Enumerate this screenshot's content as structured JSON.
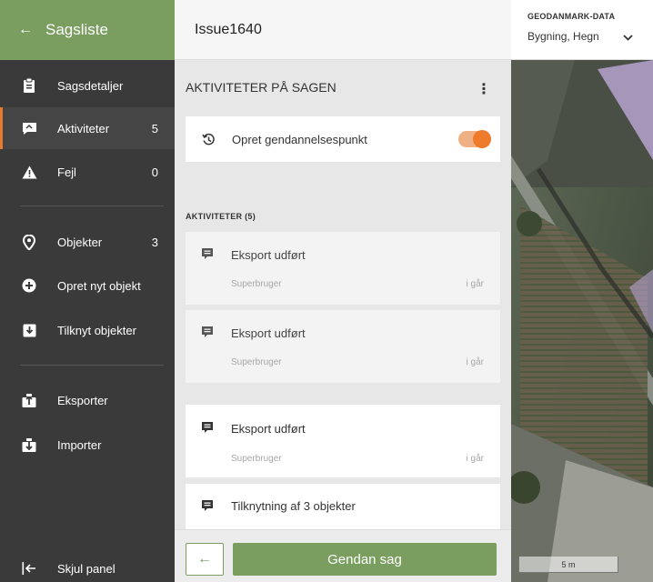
{
  "sidebar": {
    "header_label": "Sagsliste",
    "items": [
      {
        "label": "Sagsdetaljer",
        "count": ""
      },
      {
        "label": "Aktiviteter",
        "count": "5"
      },
      {
        "label": "Fejl",
        "count": "0"
      },
      {
        "label": "Objekter",
        "count": "3"
      },
      {
        "label": "Opret nyt objekt",
        "count": ""
      },
      {
        "label": "Tilknyt objekter",
        "count": ""
      },
      {
        "label": "Eksporter",
        "count": ""
      },
      {
        "label": "Importer",
        "count": ""
      }
    ],
    "hide_label": "Skjul panel"
  },
  "issue": {
    "title": "Issue1640"
  },
  "activities": {
    "section_title": "AKTIVITETER PÅ SAGEN",
    "restore_point_label": "Opret gendannelsespunkt",
    "restore_point_enabled": true,
    "list_title": "AKTIVITETER (5)",
    "items": [
      {
        "title": "Eksport udført",
        "user": "Superbruger",
        "time": "i går"
      },
      {
        "title": "Eksport udført",
        "user": "Superbruger",
        "time": "i går"
      },
      {
        "title": "Eksport udført",
        "user": "Superbruger",
        "time": "i går"
      },
      {
        "title": "Tilknytning af 3 objekter",
        "user": "",
        "time": ""
      }
    ]
  },
  "footer": {
    "restore_button": "Gendan sag"
  },
  "geodata": {
    "label": "GEODANMARK-DATA",
    "selected": "Bygning, Hegn"
  },
  "map": {
    "scale_label": "5 m"
  },
  "colors": {
    "accent_green": "#7a9e5f",
    "accent_orange": "#ee7a2c",
    "sidebar_bg": "#3a3a3a"
  }
}
